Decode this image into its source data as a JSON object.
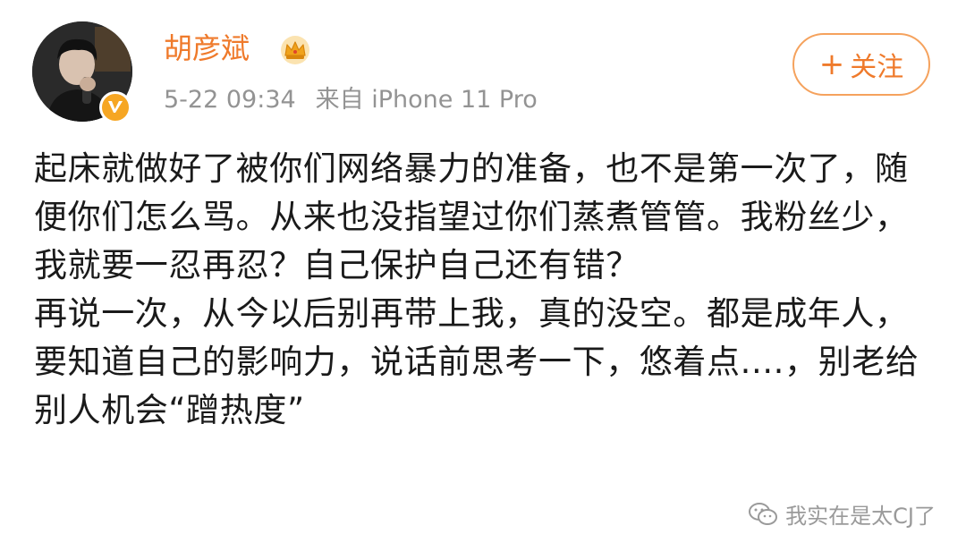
{
  "header": {
    "username": "胡彦斌",
    "date": "5-22 09:34",
    "source": "来自 iPhone 11 Pro",
    "follow_plus": "+",
    "follow_label": "关注"
  },
  "content": {
    "paragraph_1": "起床就做好了被你们网络暴力的准备，也不是第一次了，随便你们怎么骂。从来也没指望过你们蒸煮管管。我粉丝少，我就要一忍再忍？自己保护自己还有错？",
    "paragraph_2": "再说一次，从今以后别再带上我，真的没空。都是成年人，要知道自己的影响力，说话前思考一下，悠着点....，别老给别人机会“蹭热度”"
  },
  "watermark": {
    "text": "我实在是太CJ了"
  },
  "icons": {
    "crown": "vip-crown-icon",
    "verified": "verified-v-icon",
    "wechat": "wechat-icon"
  },
  "colors": {
    "accent": "#ef7a2b",
    "meta": "#939393",
    "text": "#1a1a1a",
    "badge": "#f6a623"
  }
}
